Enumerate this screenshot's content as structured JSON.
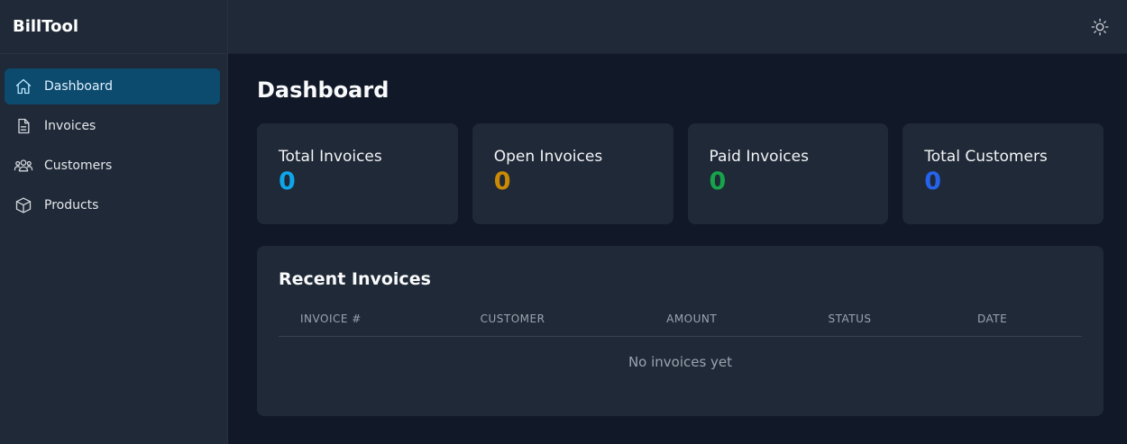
{
  "app": {
    "brand": "BillTool"
  },
  "sidebar": {
    "items": [
      {
        "label": "Dashboard",
        "icon": "home-icon",
        "active": true
      },
      {
        "label": "Invoices",
        "icon": "document-icon",
        "active": false
      },
      {
        "label": "Customers",
        "icon": "users-icon",
        "active": false
      },
      {
        "label": "Products",
        "icon": "cube-icon",
        "active": false
      }
    ]
  },
  "topbar": {
    "theme_icon": "sun-icon"
  },
  "main": {
    "title": "Dashboard",
    "stats": [
      {
        "label": "Total Invoices",
        "value": "0",
        "color": "#0ea5e9"
      },
      {
        "label": "Open Invoices",
        "value": "0",
        "color": "#ca8a04"
      },
      {
        "label": "Paid Invoices",
        "value": "0",
        "color": "#16a34a"
      },
      {
        "label": "Total Customers",
        "value": "0",
        "color": "#2563eb"
      }
    ],
    "recent": {
      "title": "Recent Invoices",
      "columns": [
        "INVOICE #",
        "CUSTOMER",
        "AMOUNT",
        "STATUS",
        "DATE"
      ],
      "empty_text": "No invoices yet"
    }
  }
}
